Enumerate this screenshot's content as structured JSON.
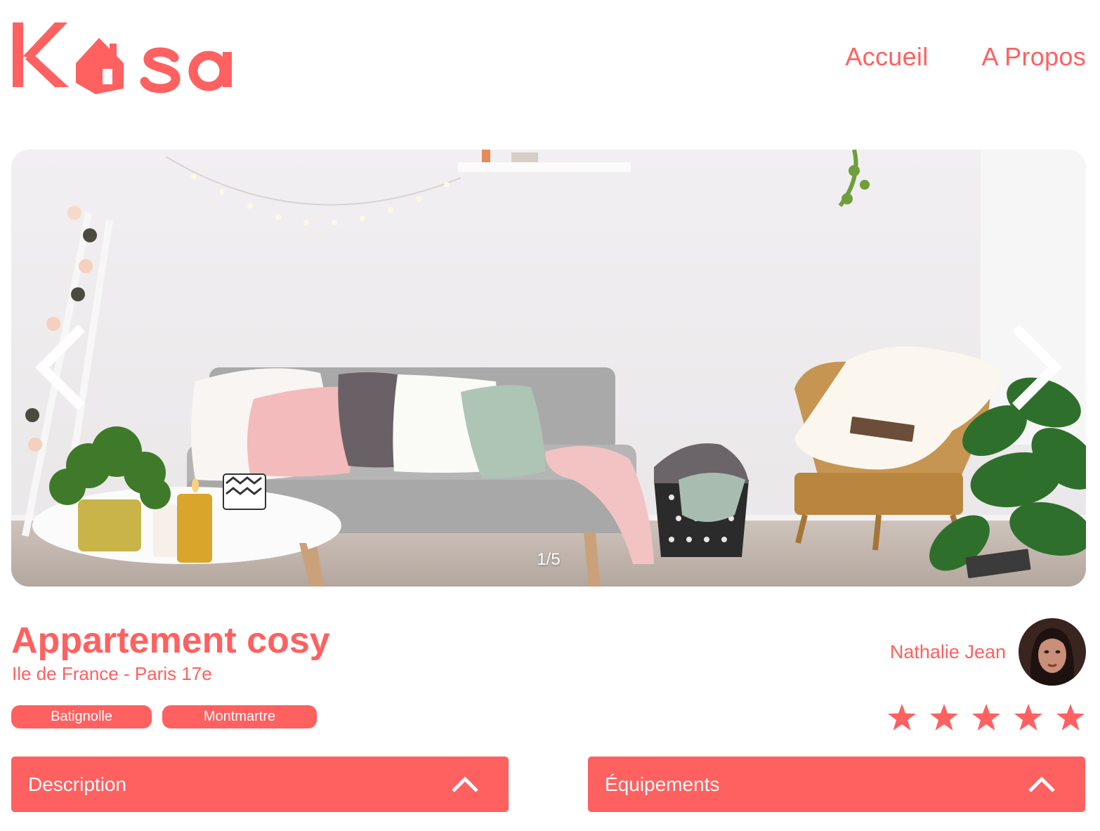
{
  "brand": {
    "logo_text": "Kasa",
    "color": "#FF6060"
  },
  "nav": {
    "home": "Accueil",
    "about": "A Propos"
  },
  "gallery": {
    "counter": "1/5",
    "prev_icon": "chevron-left-icon",
    "next_icon": "chevron-right-icon"
  },
  "listing": {
    "title": "Appartement cosy",
    "location": "Ile de France - Paris 17e",
    "tags": [
      "Batignolle",
      "Montmartre"
    ],
    "rating": 5,
    "rating_max": 5
  },
  "host": {
    "name": "Nathalie Jean"
  },
  "sections": [
    {
      "title": "Description",
      "icon": "chevron-up-icon"
    },
    {
      "title": "Équipements",
      "icon": "chevron-up-icon"
    }
  ]
}
